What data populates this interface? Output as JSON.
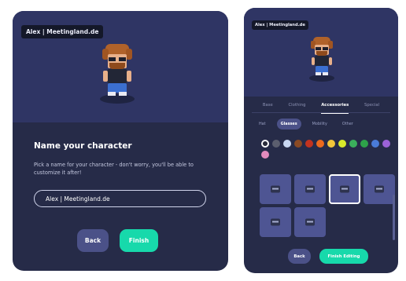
{
  "left_panel": {
    "name_tag": "Alex | Meetingland.de",
    "title": "Name your character",
    "description": "Pick a name for your character - don't worry, you'll be able to customize it after!",
    "name_input_value": "Alex | Meetingland.de",
    "back_label": "Back",
    "finish_label": "Finish"
  },
  "right_panel": {
    "name_tag": "Alex | Meetingland.de",
    "tabs": [
      "Base",
      "Clothing",
      "Accessories",
      "Special"
    ],
    "active_tab": "Accessories",
    "subtabs": [
      "Hat",
      "Glasses",
      "Mobility",
      "Other"
    ],
    "active_subtab": "Glasses",
    "swatches": [
      "#2d2f3c",
      "#5b5e6e",
      "#c8d7f2",
      "#8a4a24",
      "#c2331f",
      "#ec6a1d",
      "#f2c73a",
      "#d8ea2a",
      "#3bb05c",
      "#2ea24a",
      "#4a7bd8",
      "#9c62d7",
      "#e38bbd"
    ],
    "selected_swatch_index": 0,
    "glasses_items": 6,
    "selected_glasses_index": 2,
    "back_label": "Back",
    "finish_editing_label": "Finish Editing"
  },
  "colors": {
    "panel_bg": "#262b48",
    "preview_bg": "#2f3564",
    "accent": "#17d9ab",
    "secondary_button": "#4b5188"
  }
}
